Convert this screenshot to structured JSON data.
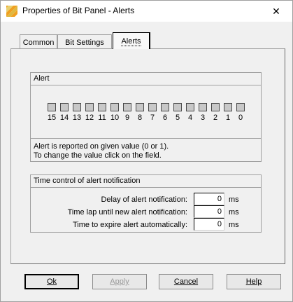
{
  "window": {
    "title": "Properties of Bit Panel - Alerts",
    "close_glyph": "✕"
  },
  "tabs": [
    {
      "label": "Common",
      "active": false
    },
    {
      "label": "Bit Settings",
      "active": false
    },
    {
      "label": "Alerts",
      "active": true
    }
  ],
  "alert_group": {
    "header": "Alert",
    "bits": [
      "15",
      "14",
      "13",
      "12",
      "11",
      "10",
      "9",
      "8",
      "7",
      "6",
      "5",
      "4",
      "3",
      "2",
      "1",
      "0"
    ],
    "info_line1": "Alert is reported on given value (0 or 1).",
    "info_line2": "To change the value click on the field."
  },
  "time_group": {
    "header": "Time control of alert notification",
    "rows": [
      {
        "label": "Delay of alert notification:",
        "value": "0",
        "unit": "ms"
      },
      {
        "label": "Time lap until new alert notification:",
        "value": "0",
        "unit": "ms"
      },
      {
        "label": "Time to expire alert automatically:",
        "value": "0",
        "unit": "ms"
      }
    ]
  },
  "buttons": {
    "ok": "Ok",
    "apply": "Apply",
    "cancel": "Cancel",
    "help": "Help"
  },
  "icons": {
    "app": "bit-panel-icon",
    "close": "close-icon"
  },
  "colors": {
    "bit_box_fill": "#c8c8c8",
    "window_bg": "#f0f0f0"
  }
}
